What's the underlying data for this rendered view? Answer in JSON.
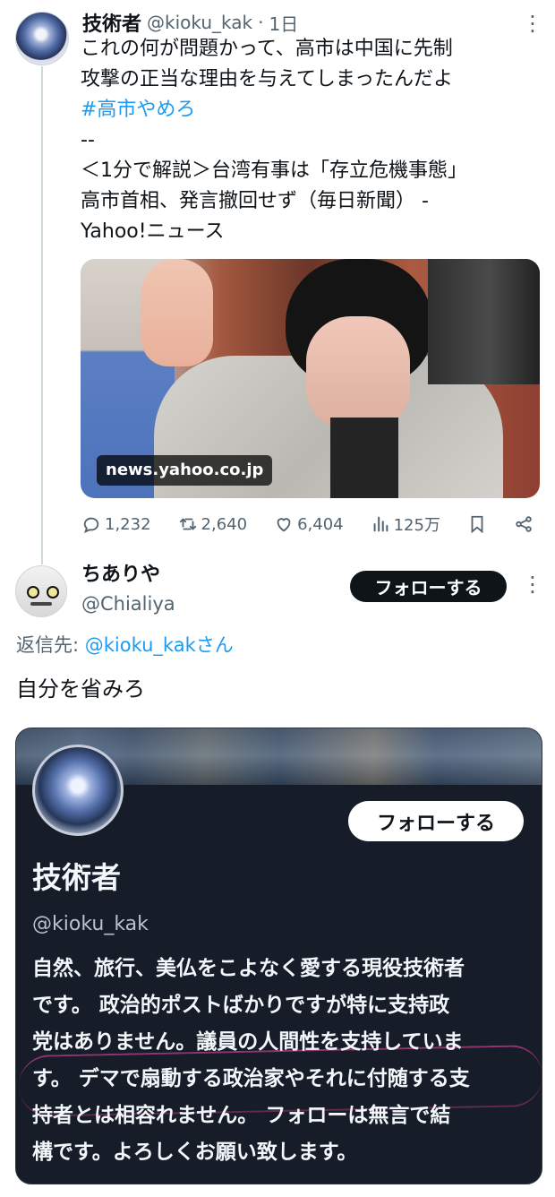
{
  "post": {
    "author": "技術者",
    "handle": "@kioku_kak",
    "separator": "·",
    "time": "1日",
    "lines": [
      "これの何が問題かって、高市は中国に先制",
      "攻撃の正当な理由を与えてしまったんだよ",
      "#高市やめろ",
      "--",
      "＜1分で解説＞台湾有事は「存立危機事態」",
      "高市首相、発言撤回せず（毎日新聞） -",
      "Yahoo!ニュース"
    ],
    "link_domain": "news.yahoo.co.jp",
    "actions": {
      "replies": "1,232",
      "reposts": "2,640",
      "likes": "6,404",
      "views": "125万"
    }
  },
  "reply": {
    "author": "ちありや",
    "handle": "@Chialiya",
    "follow_label": "フォローする",
    "reply_to_prefix": "返信先: ",
    "reply_to_handle": "@kioku_kakさん",
    "text": "自分を省みろ"
  },
  "profile_card": {
    "follow_label": "フォローする",
    "name": "技術者",
    "handle": "@kioku_kak",
    "bio_lines": [
      "自然、旅行、美仏をこよなく愛する現役技術者",
      "です。 政治的ポストばかりですが特に支持政",
      "党はありません。議員の人間性を支持していま",
      "す。 デマで扇動する政治家やそれに付随する支",
      "持者とは相容れません。 フォローは無言で結",
      "構です。よろしくお願い致します。"
    ]
  },
  "icons": {
    "more": "more-vertical-icon",
    "reply": "reply-icon",
    "repost": "repost-icon",
    "like": "heart-icon",
    "views": "analytics-icon",
    "bookmark": "bookmark-icon",
    "share": "share-icon"
  },
  "colors": {
    "link": "#1d9bf0",
    "muted": "#536471",
    "card_background": "#161d28",
    "primary_button": "#0f1419"
  }
}
